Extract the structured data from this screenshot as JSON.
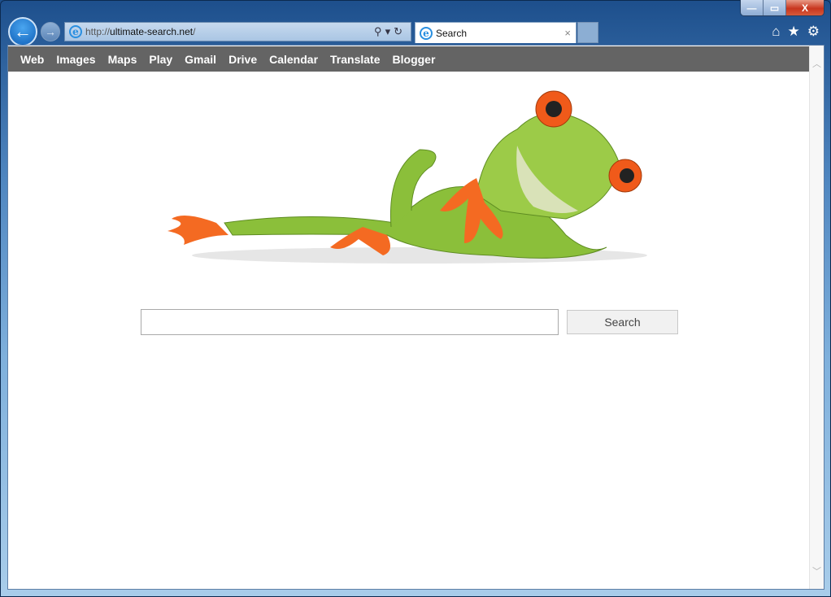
{
  "browser": {
    "url_prefix": "http://",
    "url_host": "ultimate-search.net",
    "url_suffix": "/",
    "tab_title": "Search",
    "tab_close": "×",
    "window_controls": {
      "minimize": "—",
      "maximize": "▭",
      "close": "X"
    },
    "toolbar_icons": [
      "home-icon",
      "star-icon",
      "gear-icon"
    ]
  },
  "nav": {
    "items": [
      "Web",
      "Images",
      "Maps",
      "Play",
      "Gmail",
      "Drive",
      "Calendar",
      "Translate",
      "Blogger"
    ]
  },
  "search": {
    "value": "",
    "button_label": "Search"
  },
  "colors": {
    "nav_bg": "#646464",
    "frog_green": "#8bbf3a",
    "frog_orange": "#f05a1a"
  }
}
